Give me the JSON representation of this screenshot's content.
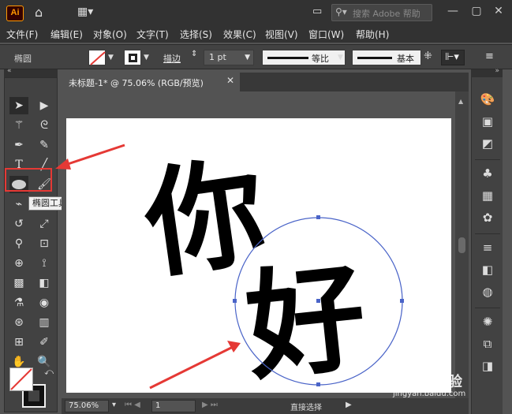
{
  "app": {
    "logo": "Ai",
    "search_placeholder": "搜索 Adobe 帮助"
  },
  "menu": [
    "文件(F)",
    "编辑(E)",
    "对象(O)",
    "文字(T)",
    "选择(S)",
    "效果(C)",
    "视图(V)",
    "窗口(W)",
    "帮助(H)"
  ],
  "control": {
    "object_name": "椭圆",
    "stroke_label": "描边",
    "stroke_weight": "1 pt",
    "profile_label": "等比",
    "brush_label": "基本"
  },
  "document": {
    "tab_title": "未标题-1* @ 75.06% (RGB/预览)",
    "close": "✕"
  },
  "tooltip": "椭圆工具 (L)",
  "status": {
    "zoom": "75.06%",
    "page": "1",
    "tool_name": "直接选择"
  },
  "artwork": {
    "calligraphy": [
      "你",
      "好"
    ]
  },
  "watermark": {
    "text": "Baidu经验",
    "url": "jingyan.baidu.com"
  },
  "colors": {
    "highlight": "#e53935",
    "selection": "#4a64c8",
    "ai_orange": "#ff9a00"
  }
}
